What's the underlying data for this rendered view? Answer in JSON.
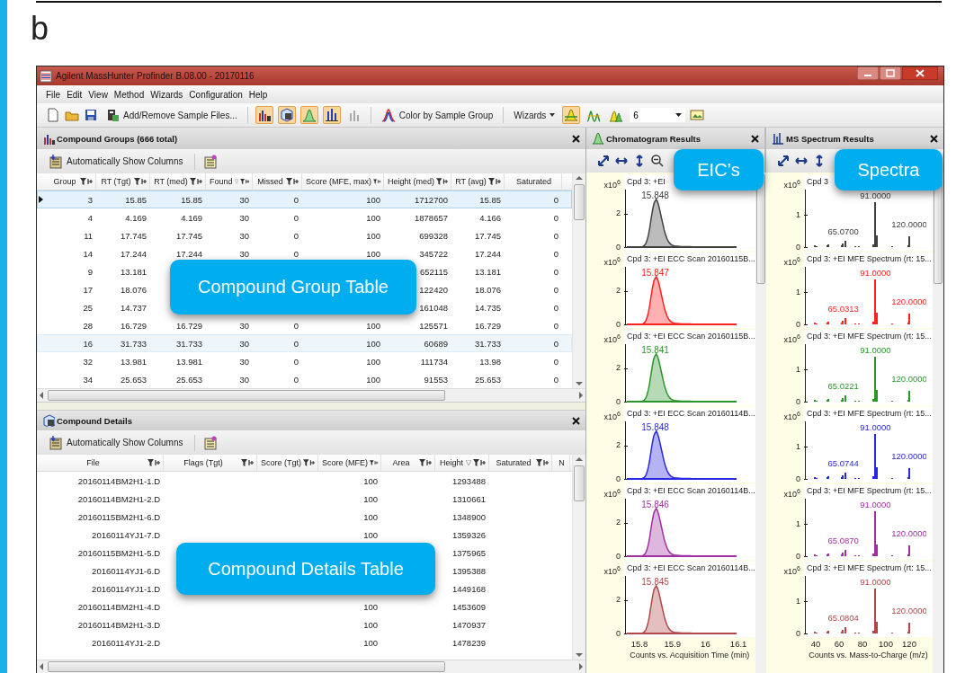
{
  "figure_label": "b",
  "window": {
    "title": "Agilent MassHunter Profinder B.08.00 - 20170116"
  },
  "menu": [
    "File",
    "Edit",
    "View",
    "Method",
    "Wizards",
    "Configuration",
    "Help"
  ],
  "toolbar": {
    "add_files": "Add/Remove Sample Files...",
    "view_toggles": [
      {
        "on": true
      },
      {
        "on": true
      },
      {
        "on": true
      },
      {
        "on": true
      },
      {
        "on": false
      }
    ],
    "color_by": "Color by Sample Group",
    "wizards": "Wizards",
    "mode_toggles": [
      {
        "on": true
      },
      {
        "on": false
      },
      {
        "on": false
      }
    ],
    "count": "6"
  },
  "compound_groups": {
    "title": "Compound Groups (666 total)",
    "toolbar_label": "Automatically Show Columns",
    "callout": "Compound Group Table",
    "columns": [
      {
        "label": "Group",
        "sorted": false
      },
      {
        "label": "RT (Tgt)",
        "sorted": false
      },
      {
        "label": "RT (med)",
        "sorted": false
      },
      {
        "label": "Found",
        "sorted": true
      },
      {
        "label": "Missed",
        "sorted": false
      },
      {
        "label": "Score (MFE, max)",
        "sorted": false
      },
      {
        "label": "Height (med)",
        "sorted": false
      },
      {
        "label": "RT (avg)",
        "sorted": false
      },
      {
        "label": "Saturated",
        "sorted": false
      }
    ],
    "rows": [
      {
        "selected": true,
        "highlighted": false,
        "cells": [
          "3",
          "15.85",
          "15.85",
          "30",
          "0",
          "100",
          "1712700",
          "15.85",
          "0"
        ]
      },
      {
        "selected": false,
        "highlighted": false,
        "cells": [
          "4",
          "4.169",
          "4.169",
          "30",
          "0",
          "100",
          "1878657",
          "4.166",
          "0"
        ]
      },
      {
        "selected": false,
        "highlighted": false,
        "cells": [
          "11",
          "17.745",
          "17.745",
          "30",
          "0",
          "100",
          "699328",
          "17.745",
          "0"
        ]
      },
      {
        "selected": false,
        "highlighted": false,
        "cells": [
          "14",
          "17.244",
          "17.244",
          "30",
          "0",
          "100",
          "345722",
          "17.244",
          "0"
        ]
      },
      {
        "selected": false,
        "highlighted": false,
        "cells": [
          "9",
          "13.181",
          null,
          null,
          null,
          null,
          "652115",
          "13.181",
          "0"
        ]
      },
      {
        "selected": false,
        "highlighted": false,
        "cells": [
          "17",
          "18.076",
          null,
          null,
          null,
          null,
          "122420",
          "18.076",
          "0"
        ]
      },
      {
        "selected": false,
        "highlighted": false,
        "cells": [
          "25",
          "14.737",
          null,
          null,
          null,
          null,
          "161048",
          "14.735",
          "0"
        ]
      },
      {
        "selected": false,
        "highlighted": false,
        "cells": [
          "28",
          "16.729",
          "16.729",
          "30",
          "0",
          "100",
          "125571",
          "16.729",
          "0"
        ]
      },
      {
        "selected": false,
        "highlighted": true,
        "cells": [
          "16",
          "31.733",
          "31.733",
          "30",
          "0",
          "100",
          "60689",
          "31.733",
          "0"
        ]
      },
      {
        "selected": false,
        "highlighted": false,
        "cells": [
          "32",
          "13.981",
          "13.981",
          "30",
          "0",
          "100",
          "111734",
          "13.98",
          "0"
        ]
      },
      {
        "selected": false,
        "highlighted": false,
        "cells": [
          "34",
          "25.653",
          "25.653",
          "30",
          "0",
          "100",
          "91553",
          "25.653",
          "0"
        ]
      }
    ]
  },
  "compound_details": {
    "title": "Compound Details",
    "toolbar_label": "Automatically Show Columns",
    "callout": "Compound Details Table",
    "columns": [
      {
        "label": "File",
        "sorted": false
      },
      {
        "label": "Flags (Tgt)",
        "sorted": false
      },
      {
        "label": "Score (Tgt)",
        "sorted": false
      },
      {
        "label": "Score (MFE)",
        "sorted": false
      },
      {
        "label": "Area",
        "sorted": false
      },
      {
        "label": "Height",
        "sorted": true
      },
      {
        "label": "Saturated",
        "sorted": false
      },
      {
        "label": "N",
        "sorted": false
      }
    ],
    "rows": [
      {
        "cells": [
          "20160114BM2H1-1.D",
          null,
          null,
          "100",
          null,
          "1293488",
          null
        ]
      },
      {
        "cells": [
          "20160114BM2H1-2.D",
          null,
          null,
          "100",
          null,
          "1310661",
          null
        ]
      },
      {
        "cells": [
          "20160115BM2H1-6.D",
          null,
          null,
          "100",
          null,
          "1348900",
          null
        ]
      },
      {
        "cells": [
          "20160114YJ1-7.D",
          null,
          null,
          "100",
          null,
          "1359326",
          null
        ]
      },
      {
        "cells": [
          "20160115BM2H1-5.D",
          null,
          null,
          null,
          null,
          "1375965",
          null
        ]
      },
      {
        "cells": [
          "20160114YJ1-6.D",
          null,
          null,
          null,
          null,
          "1395388",
          null
        ]
      },
      {
        "cells": [
          "20160114YJ1-1.D",
          null,
          null,
          null,
          null,
          "1449168",
          null
        ]
      },
      {
        "cells": [
          "20160114BM2H1-4.D",
          null,
          null,
          "100",
          null,
          "1453609",
          null
        ]
      },
      {
        "cells": [
          "20160114BM2H1-3.D",
          null,
          null,
          "100",
          null,
          "1470937",
          null
        ]
      },
      {
        "cells": [
          "20160114YJ1-2.D",
          null,
          null,
          "100",
          null,
          "1478239",
          null
        ]
      }
    ]
  },
  "chromatogram": {
    "title": "Chromatogram Results",
    "callout": "EIC’s",
    "xticks": [
      "15.8",
      "15.9",
      "16",
      "16.1"
    ],
    "xlabel": "Counts vs. Acquisition Time (min)",
    "plots": [
      {
        "title": "Cpd 3: +EI",
        "scale": "x10$^{6}$",
        "yticks": [
          "2",
          "0"
        ],
        "peak_label": "15.848",
        "color": "#404040"
      },
      {
        "title": "Cpd 3: +EI ECC Scan 20160115B...",
        "scale": "x10$^{6}$",
        "yticks": [
          "2",
          "0"
        ],
        "peak_label": "15.847",
        "color": "#ff2020"
      },
      {
        "title": "Cpd 3: +EI ECC Scan 20160115B...",
        "scale": "x10$^{6}$",
        "yticks": [
          "2",
          "0"
        ],
        "peak_label": "15.841",
        "color": "#2a962a"
      },
      {
        "title": "Cpd 3: +EI ECC Scan 20160114B...",
        "scale": "x10$^{6}$",
        "yticks": [
          "2",
          "0"
        ],
        "peak_label": "15.848",
        "color": "#2828e0"
      },
      {
        "title": "Cpd 3: +EI ECC Scan 20160114B...",
        "scale": "x10$^{6}$",
        "yticks": [
          "2",
          "0"
        ],
        "peak_label": "15.846",
        "color": "#a030a0"
      },
      {
        "title": "Cpd 3: +EI ECC Scan 20160114B...",
        "scale": "x10$^{6}$",
        "yticks": [
          "2",
          "0"
        ],
        "peak_label": "15.845",
        "color": "#b04848"
      }
    ]
  },
  "spectrum": {
    "title": "MS Spectrum Results",
    "callout": "Spectra",
    "xticks": [
      "40",
      "60",
      "80",
      "100",
      "120"
    ],
    "xlabel": "Counts vs. Mass-to-Charge (m/z)",
    "plots": [
      {
        "title": "Cpd 3",
        "scale": "x10$^{6}$",
        "yticks": [
          "1",
          "0"
        ],
        "peak_labels": [
          "91.0000",
          "65.0700",
          "120.0000"
        ],
        "color": "#404040"
      },
      {
        "title": "Cpd 3: +EI MFE Spectrum (rt: 15...",
        "scale": "x10$^{6}$",
        "yticks": [
          "1",
          "0"
        ],
        "peak_labels": [
          "91.0000",
          "65.0313",
          "120.0000"
        ],
        "color": "#ff2020"
      },
      {
        "title": "Cpd 3: +EI MFE Spectrum (rt: 15...",
        "scale": "x10$^{6}$",
        "yticks": [
          "1",
          "0"
        ],
        "peak_labels": [
          "91.0000",
          "65.0221",
          "120.0000"
        ],
        "color": "#2a962a"
      },
      {
        "title": "Cpd 3: +EI MFE Spectrum (rt: 15...",
        "scale": "x10$^{6}$",
        "yticks": [
          "1",
          "0"
        ],
        "peak_labels": [
          "91.0000",
          "65.0744",
          "120.0000"
        ],
        "color": "#2828e0"
      },
      {
        "title": "Cpd 3: +EI MFE Spectrum (rt: 15...",
        "scale": "x10$^{6}$",
        "yticks": [
          "1",
          "0"
        ],
        "peak_labels": [
          "91.0000",
          "65.0870",
          "120.0000"
        ],
        "color": "#a030a0"
      },
      {
        "title": "Cpd 3: +EI MFE Spectrum (rt: 15...",
        "scale": "x10$^{6}$",
        "yticks": [
          "1",
          "0"
        ],
        "peak_labels": [
          "91.0000",
          "65.0804",
          "120.0000"
        ],
        "color": "#b04848"
      }
    ]
  }
}
